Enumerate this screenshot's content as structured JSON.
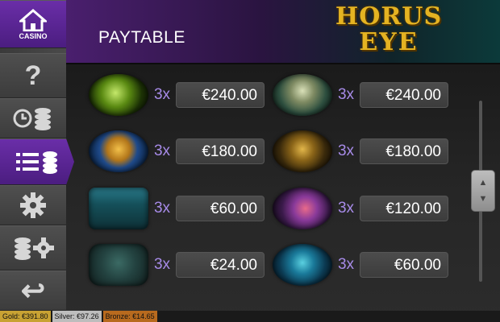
{
  "sidebar": {
    "casino_label": "CASINO",
    "help_glyph": "?",
    "return_glyph": "↩"
  },
  "header": {
    "title": "PAYTABLE"
  },
  "logo": {
    "line1": "HORUS",
    "line2": "EYE"
  },
  "paytable": {
    "left": [
      {
        "symbol": "scarab",
        "mult": "3x",
        "value": "€240.00"
      },
      {
        "symbol": "pharaoh-mask",
        "mult": "3x",
        "value": "€180.00"
      },
      {
        "symbol": "treasure-chest",
        "mult": "3x",
        "value": "€60.00"
      },
      {
        "symbol": "stone-tablet",
        "mult": "3x",
        "value": "€24.00"
      }
    ],
    "right": [
      {
        "symbol": "mummy",
        "mult": "3x",
        "value": "€240.00"
      },
      {
        "symbol": "ankh",
        "mult": "3x",
        "value": "€180.00"
      },
      {
        "symbol": "sacred-feather",
        "mult": "3x",
        "value": "€120.00"
      },
      {
        "symbol": "anubis-jackal",
        "mult": "3x",
        "value": "€60.00"
      }
    ]
  },
  "footer": {
    "gold": "Gold: €391.80",
    "silver": "Silver: €97.26",
    "bronze": "Bronze: €14.65"
  },
  "colors": {
    "accent": "#5b2591",
    "multiplier": "#a78be8",
    "logo_gold": "#e4b322"
  }
}
